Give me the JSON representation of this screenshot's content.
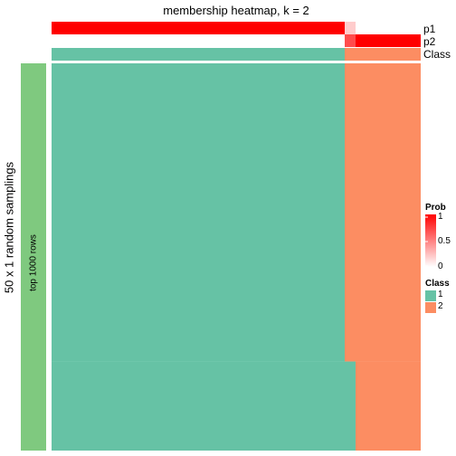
{
  "chart_data": {
    "type": "heatmap",
    "title": "membership heatmap, k = 2",
    "ylabel": "50 x 1 random samplings",
    "row_group_label": "top 1000 rows",
    "row_group_color": "#7FC97F",
    "n_rows": 50,
    "n_columns": 34,
    "columns_segments": [
      {
        "class": 1,
        "count": 27,
        "p1": 1.0,
        "p2": 0.0
      },
      {
        "class": 2,
        "count": 1,
        "p1": 0.2,
        "p2": 0.7
      },
      {
        "class": 2,
        "count": 6,
        "p1": 0.0,
        "p2": 1.0
      }
    ],
    "membership_note": "Most sampled rows assign columns 1-27 to class 1; in the bottom ~10 of 50 samplings column 28 is assigned to class 1 as well",
    "row_switch_fraction": 0.77,
    "annotations": [
      {
        "name": "p1"
      },
      {
        "name": "p2"
      },
      {
        "name": "Class"
      }
    ],
    "legends": {
      "prob": {
        "title": "Prob",
        "ticks": [
          "1",
          "0.5",
          "0"
        ],
        "range": [
          0,
          1
        ],
        "low_color": "#FFFFFF",
        "high_color": "#FF0000"
      },
      "class": {
        "title": "Class",
        "entries": [
          {
            "label": "1",
            "color": "#66C2A5"
          },
          {
            "label": "2",
            "color": "#FC8D62"
          }
        ]
      }
    }
  }
}
